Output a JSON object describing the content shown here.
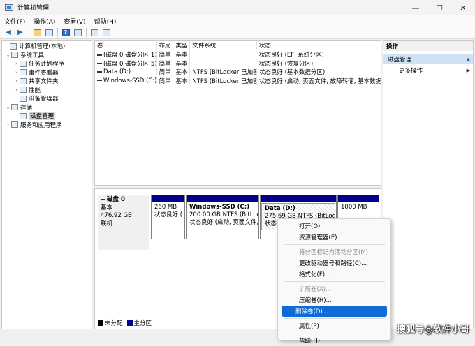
{
  "window": {
    "title": "计算机管理"
  },
  "controls": {
    "minimize": "—",
    "maximize": "☐",
    "close": "✕"
  },
  "menu": [
    "文件(F)",
    "操作(A)",
    "查看(V)",
    "帮助(H)"
  ],
  "toolbar": {
    "back": "◀",
    "forward": "▶",
    "help": "?"
  },
  "tree": [
    {
      "label": "计算机管理(本地)",
      "arrow": "",
      "level": 0
    },
    {
      "label": "系统工具",
      "arrow": "⌄",
      "level": 1
    },
    {
      "label": "任务计划程序",
      "arrow": "›",
      "level": 2
    },
    {
      "label": "事件查看器",
      "arrow": "›",
      "level": 2
    },
    {
      "label": "共享文件夹",
      "arrow": "›",
      "level": 2
    },
    {
      "label": "性能",
      "arrow": "›",
      "level": 2
    },
    {
      "label": "设备管理器",
      "arrow": "",
      "level": 2
    },
    {
      "label": "存储",
      "arrow": "⌄",
      "level": 1
    },
    {
      "label": "磁盘管理",
      "arrow": "",
      "level": 2
    },
    {
      "label": "服务和应用程序",
      "arrow": "›",
      "level": 1
    }
  ],
  "volumes": {
    "headers": [
      "卷",
      "布局",
      "类型",
      "文件系统",
      "状态"
    ],
    "rows": [
      [
        "(磁盘 0 磁盘分区 1)",
        "简单",
        "基本",
        "",
        "状态良好 (EFI 系统分区)"
      ],
      [
        "(磁盘 0 磁盘分区 5)",
        "简单",
        "基本",
        "",
        "状态良好 (恢复分区)"
      ],
      [
        "Data (D:)",
        "简单",
        "基本",
        "NTFS (BitLocker 已加密)",
        "状态良好 (基本数据分区)"
      ],
      [
        "Windows-SSD (C:)",
        "简单",
        "基本",
        "NTFS (BitLocker 已加密)",
        "状态良好 (启动, 页面文件, 故障转储, 基本数据分"
      ]
    ]
  },
  "disk": {
    "name": "磁盘 0",
    "type": "基本",
    "size": "476.92 GB",
    "status": "联机",
    "partitions": [
      {
        "name": "",
        "line1": "260 MB",
        "line2": "状态良好 ("
      },
      {
        "name": "Windows-SSD  (C:)",
        "line1": "200.00 GB NTFS (BitLocke",
        "line2": "状态良好 (启动, 页面文件,"
      },
      {
        "name": "Data  (D:)",
        "line1": "275.69 GB NTFS (BitLocke",
        "line2": "状态良"
      },
      {
        "name": "",
        "line1": "1000 MB",
        "line2": ""
      }
    ]
  },
  "legend": {
    "unallocated": "未分配",
    "primary": "主分区",
    "unallocated_color": "#000000",
    "primary_color": "#00008b"
  },
  "actions": {
    "header": "操作",
    "section": "磁盘管理",
    "more": "更多操作"
  },
  "context_menu": {
    "groups": [
      [
        {
          "label": "打开(O)",
          "disabled": false
        },
        {
          "label": "资源管理器(E)",
          "disabled": false
        }
      ],
      [
        {
          "label": "将分区标记为活动分区(M)",
          "disabled": true
        },
        {
          "label": "更改驱动器号和路径(C)...",
          "disabled": false
        },
        {
          "label": "格式化(F)...",
          "disabled": false
        }
      ],
      [
        {
          "label": "扩展卷(X)...",
          "disabled": true
        },
        {
          "label": "压缩卷(H)...",
          "disabled": false
        },
        {
          "label": "删除卷(D)...",
          "disabled": false,
          "active": true
        }
      ],
      [
        {
          "label": "属性(P)",
          "disabled": false
        }
      ],
      [
        {
          "label": "帮助(H)",
          "disabled": false
        }
      ]
    ]
  },
  "watermark": "搜狐号@软件小哥",
  "colors": {
    "accent": "#0f6cd6",
    "partition_bar": "#00008b",
    "action_section": "#cfe1f3"
  }
}
